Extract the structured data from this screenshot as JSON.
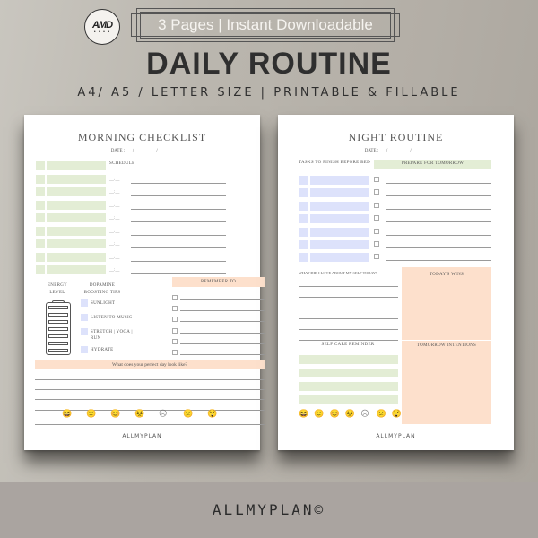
{
  "header": {
    "logo_text": "AMD",
    "badge": "3 Pages | Instant Downloadable",
    "title": "DAILY ROUTINE",
    "subtitle": "A4/ A5 / LETTER SIZE | PRINTABLE & FILLABLE"
  },
  "morning": {
    "title": "MORNING CHECKLIST",
    "date": "DATE : ___/__________/_______",
    "schedule_label": "SCHEDULE",
    "time_placeholder": "__:__",
    "energy_label": "ENERGY LEVEL",
    "dopamine_label": "DOPAMINE BOOSTING TIPS",
    "tips": [
      "SUNLIGHT",
      "LISTEN TO MUSIC",
      "STRETCH | YOGA | RUN",
      "HYDRATE"
    ],
    "remember_label": "REMEMBER TO",
    "perfect_day_label": "What does your perfect day look like?",
    "moods": [
      "😆",
      "🙂",
      "😊",
      "😣",
      "☹",
      "😕",
      "😲"
    ],
    "brand": "ALLMYPLAN"
  },
  "night": {
    "title": "NIGHT ROUTINE",
    "date": "DATE : ___/__________/_______",
    "tasks_label": "TASKS TO FINISH BEFORE BED",
    "prepare_label": "PREPARE FOR TOMORROW",
    "love_label": "WHAT DID I LOVE ABOUT MY SELF TODAY!",
    "wins_label": "TODAY'S WINS",
    "selfcare_label": "SELF CARE REMINDER",
    "intentions_label": "TOMORROW INTENTIONS",
    "moods": [
      "😆",
      "🙂",
      "😊",
      "😣",
      "☹",
      "😕",
      "😲"
    ],
    "brand": "ALLMYPLAN"
  },
  "footer": {
    "brand": "ALLMYPLAN©"
  },
  "colors": {
    "green": "#e3edd5",
    "blue": "#dde2fb",
    "peach": "#fde0cc"
  }
}
